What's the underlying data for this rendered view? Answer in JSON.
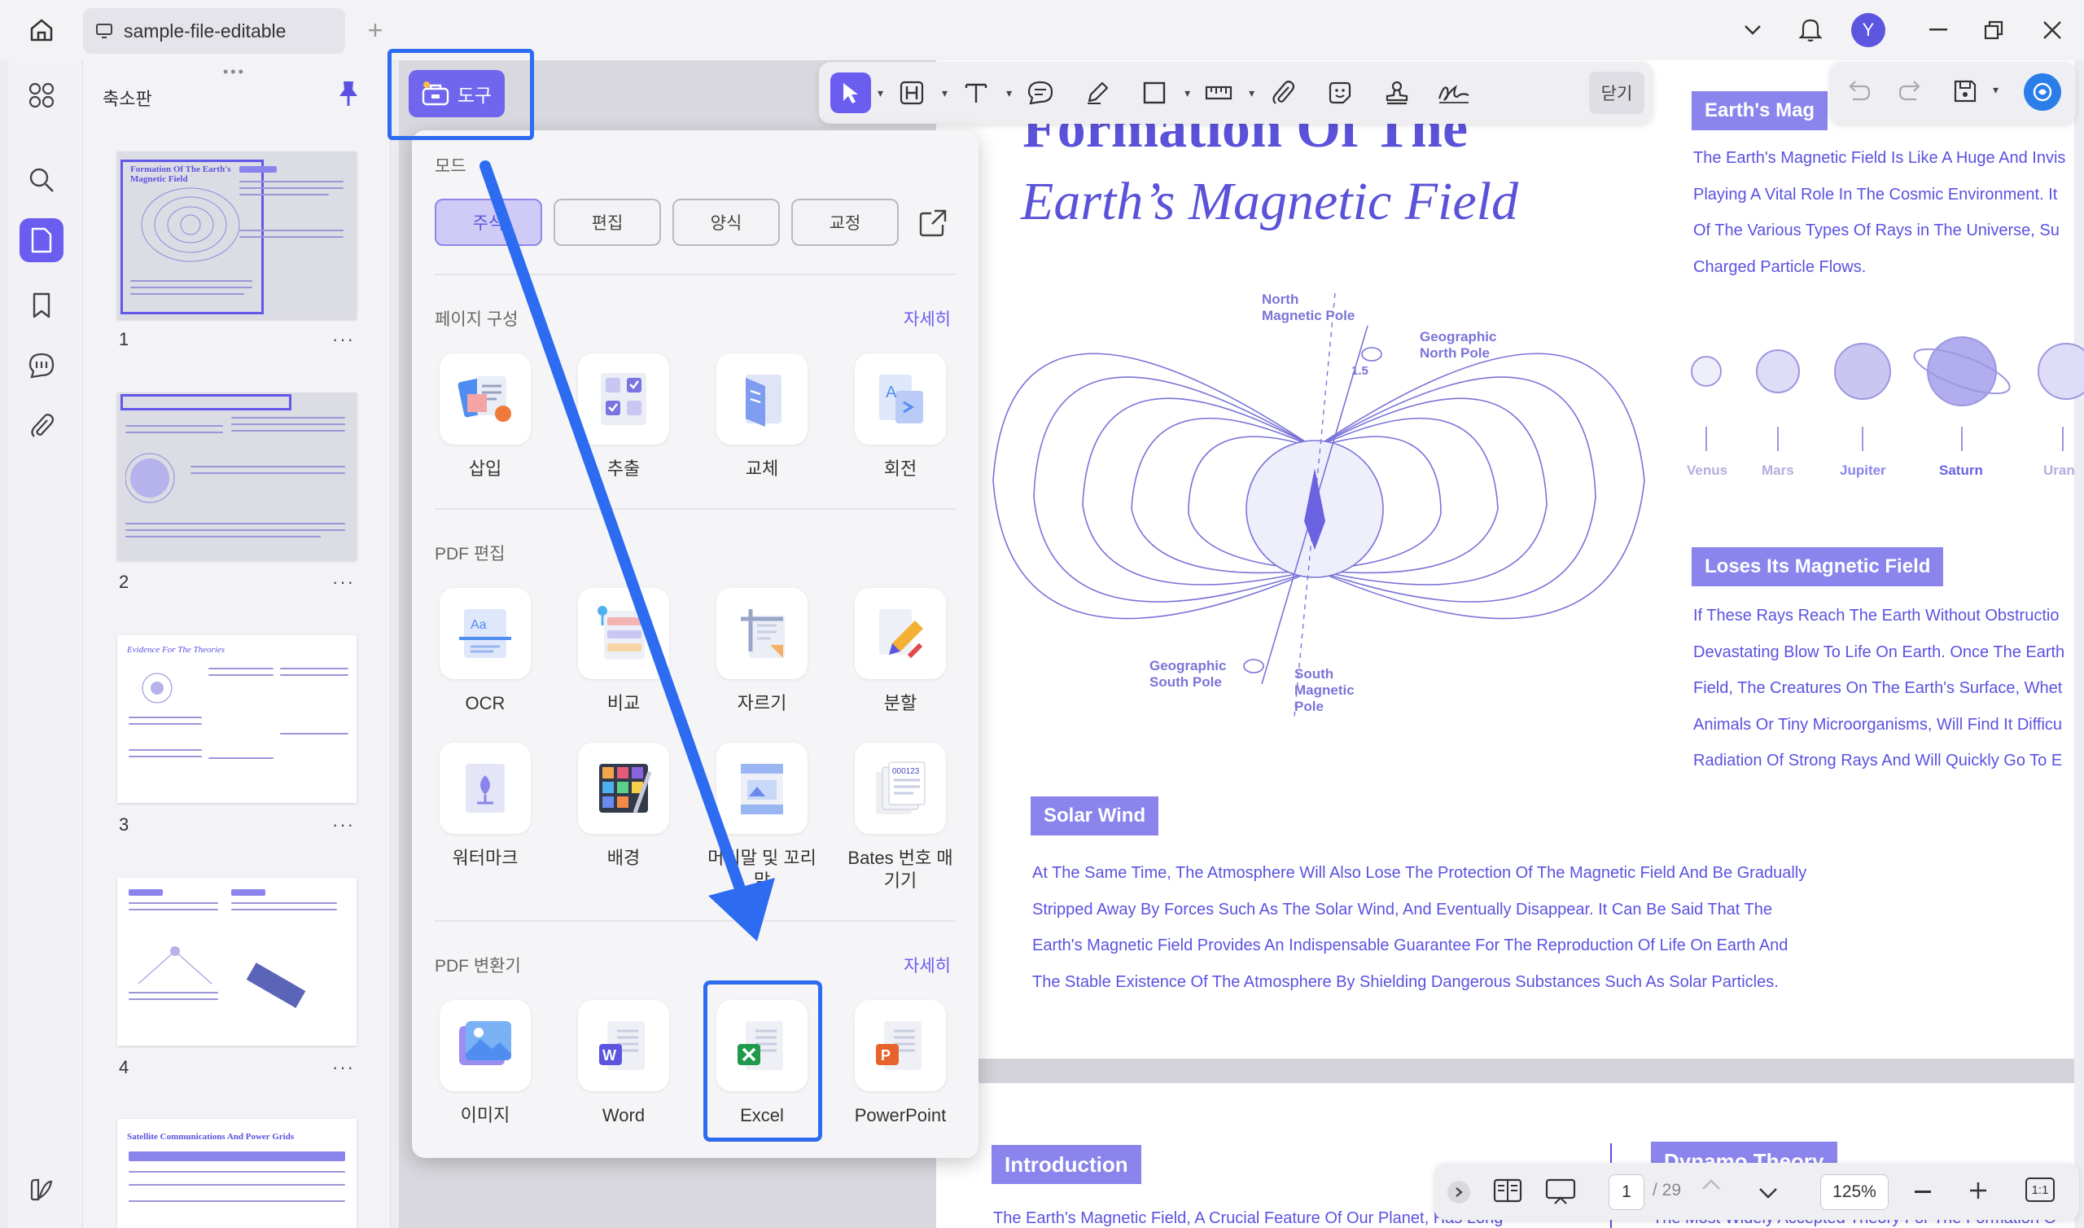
{
  "titlebar": {
    "tab_title": "sample-file-editable",
    "avatar_initial": "Y"
  },
  "thumbnails": {
    "panel_title": "축소판",
    "pages": [
      {
        "number": "1",
        "title": "Formation Of The Earth's Magnetic Field"
      },
      {
        "number": "2",
        "title": ""
      },
      {
        "number": "3",
        "title": "Evidence For The Theories"
      },
      {
        "number": "4",
        "title": ""
      },
      {
        "number": "",
        "title": "Satellite Communications And Power Grids"
      }
    ],
    "more": "···"
  },
  "tools_button": {
    "label": "도구"
  },
  "toolbar": {
    "close_label": "닫기"
  },
  "panel": {
    "mode_title": "모드",
    "modes": [
      "주석",
      "편집",
      "양식",
      "교정"
    ],
    "page_section": {
      "title": "페이지 구성",
      "more": "자세히",
      "items": [
        "삽입",
        "추출",
        "교체",
        "회전"
      ]
    },
    "edit_section": {
      "title": "PDF 편집",
      "items": [
        "OCR",
        "비교",
        "자르기",
        "분할",
        "워터마크",
        "배경",
        "머리말 및 꼬리말",
        "Bates 번호 매기기"
      ]
    },
    "convert_section": {
      "title": "PDF 변환기",
      "more": "자세히",
      "items": [
        "이미지",
        "Word",
        "Excel",
        "PowerPoint"
      ]
    }
  },
  "document": {
    "title_line1": "Formation Of The",
    "title_line2": "Earth’s Magnetic Field",
    "diagram_labels": {
      "north_magnetic": "North Magnetic Pole",
      "geo_north": "Geographic North Pole",
      "angle": "1.5",
      "geo_south": "Geographic South Pole",
      "south_magnetic": "South Magnetic Pole"
    },
    "right_tag_1": "Earth's Mag",
    "right_para_1": [
      "The Earth's Magnetic Field Is Like A Huge And Invis",
      "Playing A Vital Role In The Cosmic Environment. It",
      "Of The Various Types Of Rays in The Universe, Su",
      "Charged Particle Flows."
    ],
    "planets": [
      "Venus",
      "Mars",
      "Jupiter",
      "Saturn",
      "Uran"
    ],
    "right_tag_2": "Loses Its Magnetic Field",
    "right_para_2": [
      "If These Rays Reach The Earth Without Obstructio",
      "Devastating Blow To Life On Earth. Once The Earth",
      "Field, The Creatures On The Earth's Surface, Whet",
      "Animals Or Tiny Microorganisms, Will Find It Difficu",
      "Radiation Of Strong Rays And Will Quickly Go To E"
    ],
    "solar_tag": "Solar Wind",
    "solar_para": [
      "At The Same Time, The Atmosphere Will Also Lose The Protection Of The Magnetic Field And Be Gradually",
      "Stripped Away By Forces Such As The Solar Wind, And Eventually Disappear. It Can Be Said That The",
      "Earth's Magnetic Field Provides An Indispensable Guarantee For The Reproduction Of Life On Earth And",
      "The Stable Existence Of The Atmosphere By Shielding Dangerous Substances Such As Solar Particles."
    ],
    "intro_tag": "Introduction",
    "intro_text": "The Earth's Magnetic Field, A Crucial Feature Of Our Planet, Has Long",
    "dynamo_tag": "Dynamo Theory",
    "dynamo_text": "The Most Widely Accepted Theory For The Formation O"
  },
  "bottombar": {
    "page_current": "1",
    "page_total": "/ 29",
    "zoom": "125%",
    "fit_label": "1:1"
  }
}
